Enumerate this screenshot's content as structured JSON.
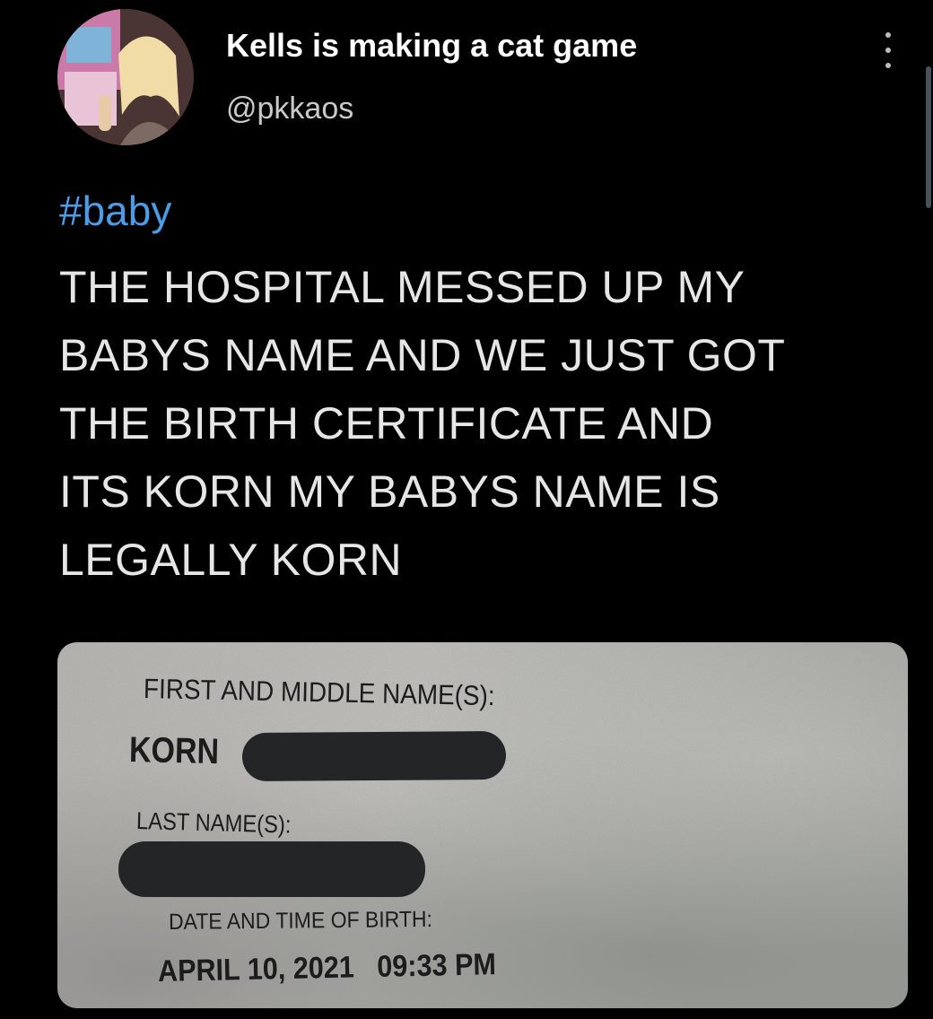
{
  "profile": {
    "display_name": "Kells is making a cat game",
    "handle": "@pkkaos",
    "avatar_icon": "profile-photo",
    "more_icon": "more-vertical-icon"
  },
  "tweet": {
    "hashtag": "#baby",
    "lines": [
      "THE HOSPITAL MESSED UP MY",
      "BABYS NAME AND WE JUST GOT",
      "THE BIRTH CERTIFICATE AND",
      "ITS KORN MY BABYS NAME IS",
      "LEGALLY KORN"
    ]
  },
  "certificate": {
    "first_middle_label": "FIRST AND MIDDLE NAME(S):",
    "first_name_value": "KORN",
    "last_name_label": "LAST NAME(S):",
    "date_label": "DATE AND TIME OF BIRTH:",
    "date_value": "APRIL 10, 2021   09:33 PM"
  },
  "colors": {
    "background": "#000000",
    "hashtag": "#4d9de6",
    "text": "#e6e6e6",
    "handle": "#c9c9c9",
    "redaction": "#242527"
  }
}
